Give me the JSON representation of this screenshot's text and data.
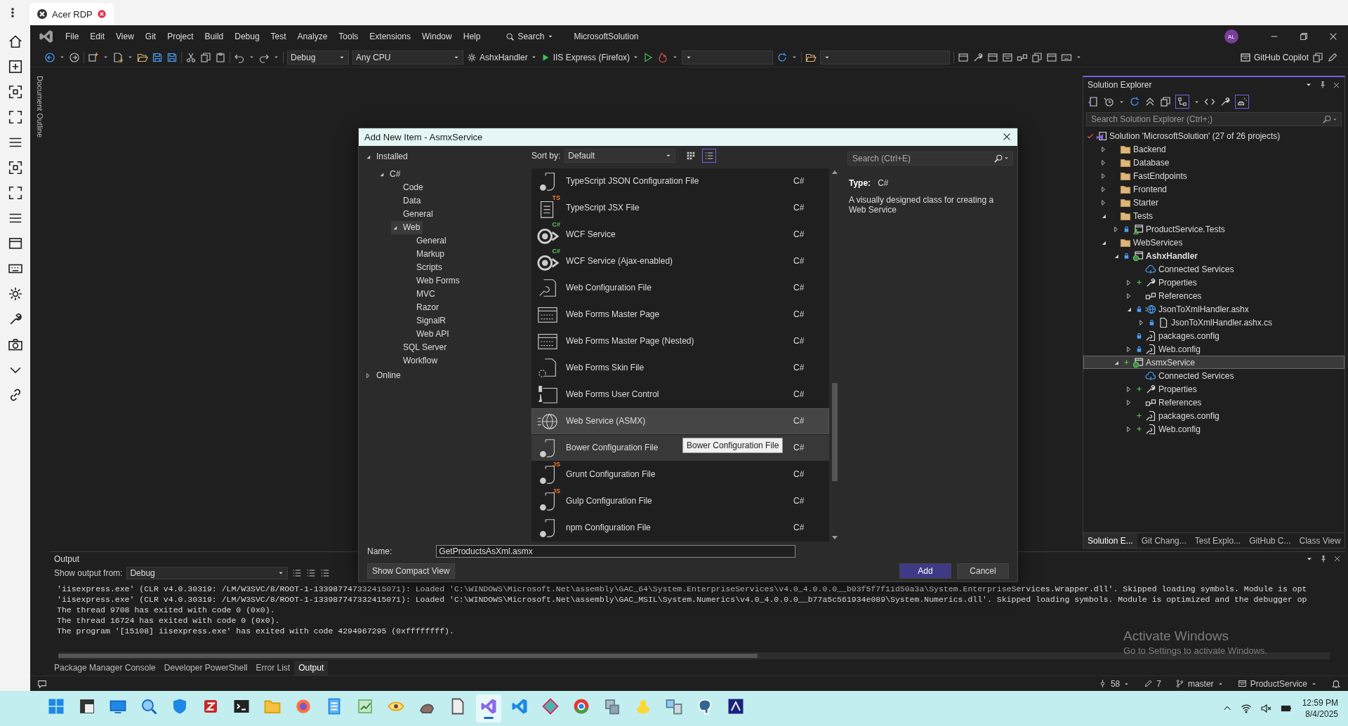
{
  "rdp_tab": {
    "title": "Acer RDP"
  },
  "menubar": {
    "menus": [
      "File",
      "Edit",
      "View",
      "Git",
      "Project",
      "Build",
      "Debug",
      "Test",
      "Analyze",
      "Tools",
      "Extensions",
      "Window",
      "Help"
    ],
    "search": "Search",
    "solution_name": "MicrosoftSolution",
    "avatar_initials": "AL"
  },
  "toolbar": {
    "configuration": "Debug",
    "platform": "Any CPU",
    "startup_project": "AshxHandler",
    "run_target": "IIS Express (Firefox)",
    "copilot": "GitHub Copilot"
  },
  "document_outline": {
    "label": "Document Outline"
  },
  "dialog": {
    "title": "Add New Item - AsmxService",
    "categories": [
      {
        "label": "Installed",
        "selected": false,
        "expanded": true,
        "children": [
          {
            "label": "C#",
            "selected": false,
            "expanded": true,
            "children": [
              {
                "label": "Code",
                "selected": false
              },
              {
                "label": "Data",
                "selected": false
              },
              {
                "label": "General",
                "selected": false
              },
              {
                "label": "Web",
                "selected": true,
                "expanded": true,
                "children": [
                  {
                    "label": "General",
                    "selected": false
                  },
                  {
                    "label": "Markup",
                    "selected": false
                  },
                  {
                    "label": "Scripts",
                    "selected": false
                  },
                  {
                    "label": "Web Forms",
                    "selected": false
                  },
                  {
                    "label": "MVC",
                    "selected": false
                  },
                  {
                    "label": "Razor",
                    "selected": false
                  },
                  {
                    "label": "SignalR",
                    "selected": false
                  },
                  {
                    "label": "Web API",
                    "selected": false
                  }
                ]
              },
              {
                "label": "SQL Server",
                "selected": false
              },
              {
                "label": "Workflow",
                "selected": false
              }
            ]
          }
        ]
      },
      {
        "label": "Online",
        "selected": false,
        "expanded": false
      }
    ],
    "sort_label": "Sort by:",
    "sort_value": "Default",
    "views": [
      {
        "kind": "grid",
        "selected": false
      },
      {
        "kind": "list",
        "selected": true
      }
    ],
    "search_placeholder": "Search (Ctrl+E)",
    "templates": [
      {
        "name": "TypeScript JSON Configuration File",
        "type": "C#",
        "kind": "config-script",
        "selected": false,
        "hovered": false
      },
      {
        "name": "TypeScript JSX File",
        "type": "C#",
        "kind": "script-file",
        "badge": "TS",
        "selected": false,
        "hovered": false
      },
      {
        "name": "WCF Service",
        "type": "C#",
        "kind": "service",
        "badge": "C#",
        "selected": false,
        "hovered": false
      },
      {
        "name": "WCF Service (Ajax-enabled)",
        "type": "C#",
        "kind": "service",
        "badge": "C#",
        "selected": false,
        "hovered": false
      },
      {
        "name": "Web Configuration File",
        "type": "C#",
        "kind": "web-config",
        "selected": false,
        "hovered": false
      },
      {
        "name": "Web Forms Master Page",
        "type": "C#",
        "kind": "master-page",
        "selected": false,
        "hovered": false
      },
      {
        "name": "Web Forms Master Page (Nested)",
        "type": "C#",
        "kind": "master-page",
        "selected": false,
        "hovered": false
      },
      {
        "name": "Web Forms Skin File",
        "type": "C#",
        "kind": "skin",
        "selected": false,
        "hovered": false
      },
      {
        "name": "Web Forms User Control",
        "type": "C#",
        "kind": "user-control",
        "selected": false,
        "hovered": false
      },
      {
        "name": "Web Service (ASMX)",
        "type": "C#",
        "kind": "web-service",
        "selected": true,
        "hovered": false
      },
      {
        "name": "Bower Configuration File",
        "type": "C#",
        "kind": "config-script",
        "selected": false,
        "hovered": true
      },
      {
        "name": "Grunt Configuration File",
        "type": "C#",
        "kind": "config-script",
        "badge": "JS",
        "selected": false,
        "hovered": false
      },
      {
        "name": "Gulp Configuration File",
        "type": "C#",
        "kind": "config-script",
        "badge": "JS",
        "selected": false,
        "hovered": false
      },
      {
        "name": "npm Configuration File",
        "type": "C#",
        "kind": "config-script",
        "selected": false,
        "hovered": false
      }
    ],
    "tooltip": "Bower Configuration File",
    "type_label": "Type:",
    "type_value": "C#",
    "description": "A visually designed class for creating a Web Service",
    "name_label": "Name:",
    "name_value": "GetProductsAsXml.asmx",
    "compact_button": "Show Compact View",
    "add_button": "Add",
    "cancel_button": "Cancel"
  },
  "solution_explorer": {
    "title": "Solution Explorer",
    "toggles": [
      {
        "on": true
      },
      {
        "on": true
      }
    ],
    "search_placeholder": "Search Solution Explorer (Ctrl+;)",
    "tree": [
      {
        "label": "Solution 'MicrosoftSolution' (27 of 26 projects)",
        "kind": "solution",
        "selected": false,
        "children": [
          {
            "label": "Backend",
            "kind": "folder",
            "selected": false,
            "expanded": false
          },
          {
            "label": "Database",
            "kind": "folder",
            "selected": false,
            "expanded": false
          },
          {
            "label": "FastEndpoints",
            "kind": "folder",
            "selected": false,
            "expanded": false
          },
          {
            "label": "Frontend",
            "kind": "folder",
            "selected": false,
            "expanded": false
          },
          {
            "label": "Starter",
            "kind": "folder",
            "selected": false,
            "expanded": false
          },
          {
            "label": "Tests",
            "kind": "folder",
            "selected": false,
            "expanded": true,
            "children": [
              {
                "label": "ProductService.Tests",
                "kind": "test-project",
                "locked": true,
                "selected": false,
                "expanded": false
              }
            ]
          },
          {
            "label": "WebServices",
            "kind": "folder",
            "selected": false,
            "expanded": true,
            "children": [
              {
                "label": "AshxHandler",
                "kind": "web-project",
                "locked": true,
                "startup": true,
                "selected": false,
                "expanded": true,
                "children": [
                  {
                    "label": "Connected Services",
                    "kind": "connected",
                    "selected": false
                  },
                  {
                    "label": "Properties",
                    "kind": "properties",
                    "added": true,
                    "selected": false,
                    "expanded": false
                  },
                  {
                    "label": "References",
                    "kind": "references",
                    "selected": false,
                    "expanded": false
                  },
                  {
                    "label": "JsonToXmlHandler.ashx",
                    "kind": "handler",
                    "locked": true,
                    "selected": false,
                    "expanded": true,
                    "children": [
                      {
                        "label": "JsonToXmlHandler.ashx.cs",
                        "kind": "code-file",
                        "locked": true,
                        "selected": false,
                        "expanded": false
                      }
                    ]
                  },
                  {
                    "label": "packages.config",
                    "kind": "config",
                    "locked": true,
                    "selected": false
                  },
                  {
                    "label": "Web.config",
                    "kind": "config",
                    "locked": true,
                    "selected": false,
                    "expanded": false
                  }
                ]
              },
              {
                "label": "AsmxService",
                "kind": "web-project",
                "added": true,
                "startup": false,
                "selected": true,
                "expanded": true,
                "children": [
                  {
                    "label": "Connected Services",
                    "kind": "connected",
                    "selected": false
                  },
                  {
                    "label": "Properties",
                    "kind": "properties",
                    "added": true,
                    "selected": false,
                    "expanded": false
                  },
                  {
                    "label": "References",
                    "kind": "references",
                    "selected": false,
                    "expanded": false
                  },
                  {
                    "label": "packages.config",
                    "kind": "config",
                    "added": true,
                    "selected": false
                  },
                  {
                    "label": "Web.config",
                    "kind": "config",
                    "added": true,
                    "selected": false,
                    "expanded": false
                  }
                ]
              }
            ]
          }
        ]
      }
    ],
    "tabs": [
      {
        "label": "Solution E...",
        "selected": true
      },
      {
        "label": "Git Chang...",
        "selected": false
      },
      {
        "label": "Test Explo...",
        "selected": false
      },
      {
        "label": "GitHub C...",
        "selected": false
      },
      {
        "label": "Class View",
        "selected": false
      }
    ]
  },
  "output": {
    "title": "Output",
    "source_label": "Show output from:",
    "source_value": "Debug",
    "lines": [
      "'iisexpress.exe' (CLR v4.0.30319: /LM/W3SVC/8/ROOT-1-133987747332415071): Loaded 'C:\\WINDOWS\\Microsoft.Net\\assembly\\GAC_64\\System.EnterpriseServices\\v4.0_4.0.0.0__b03f5f7f11d50a3a\\System.EnterpriseServices.Wrapper.dll'. Skipped loading symbols. Module is opt",
      "'iisexpress.exe' (CLR v4.0.30319: /LM/W3SVC/8/ROOT-1-133987747332415071): Loaded 'C:\\WINDOWS\\Microsoft.Net\\assembly\\GAC_MSIL\\System.Numerics\\v4.0_4.0.0.0__b77a5c561934e089\\System.Numerics.dll'. Skipped loading symbols. Module is optimized and the debugger op",
      "The thread 9708 has exited with code 0 (0x0).",
      "The thread 16724 has exited with code 0 (0x0).",
      "The program '[15108] iisexpress.exe' has exited with code 4294967295 (0xffffffff)."
    ],
    "tabs": [
      {
        "label": "Package Manager Console",
        "selected": false
      },
      {
        "label": "Developer PowerShell",
        "selected": false
      },
      {
        "label": "Error List",
        "selected": false
      },
      {
        "label": "Output",
        "selected": true
      }
    ]
  },
  "activation_notice": {
    "title": "Activate Windows",
    "hint": "Go to Settings to activate Windows."
  },
  "status_bar": {
    "pending": "58",
    "edits": "7",
    "branch": "master",
    "repository": "ProductService"
  },
  "taskbar": {
    "apps": [
      {
        "selected": false
      },
      {
        "selected": false
      },
      {
        "selected": false
      },
      {
        "selected": false
      },
      {
        "selected": false
      },
      {
        "selected": false
      },
      {
        "selected": false
      },
      {
        "selected": false
      },
      {
        "selected": false
      },
      {
        "selected": false
      },
      {
        "selected": false
      },
      {
        "selected": false
      },
      {
        "selected": false
      },
      {
        "selected": false
      },
      {
        "selected": true
      },
      {
        "selected": false
      },
      {
        "selected": false
      },
      {
        "selected": false
      },
      {
        "selected": false
      },
      {
        "selected": false
      },
      {
        "selected": false
      },
      {
        "selected": false
      },
      {
        "selected": false
      }
    ],
    "time": "12:59 PM",
    "date": "8/4/2025"
  }
}
